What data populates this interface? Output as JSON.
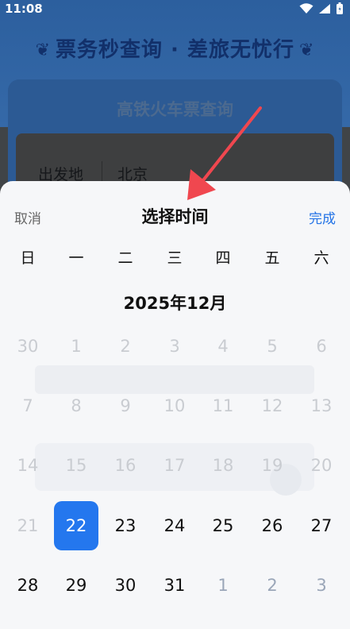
{
  "status_bar": {
    "time": "11:08"
  },
  "background": {
    "banner": "票务秒查询 · 差旅无忧行",
    "card_title": "高铁火车票查询",
    "field_label": "出发地",
    "field_value": "北京"
  },
  "sheet": {
    "cancel_label": "取消",
    "title": "选择时间",
    "done_label": "完成",
    "weekdays": [
      "日",
      "一",
      "二",
      "三",
      "四",
      "五",
      "六"
    ],
    "month_label": "2025年12月",
    "weeks": [
      [
        {
          "d": "30",
          "s": "faded"
        },
        {
          "d": "1",
          "s": "faded"
        },
        {
          "d": "2",
          "s": "faded"
        },
        {
          "d": "3",
          "s": "faded"
        },
        {
          "d": "4",
          "s": "faded"
        },
        {
          "d": "5",
          "s": "faded"
        },
        {
          "d": "6",
          "s": "faded"
        }
      ],
      [
        {
          "d": "7",
          "s": "faded"
        },
        {
          "d": "8",
          "s": "faded"
        },
        {
          "d": "9",
          "s": "faded"
        },
        {
          "d": "10",
          "s": "faded"
        },
        {
          "d": "11",
          "s": "faded"
        },
        {
          "d": "12",
          "s": "faded"
        },
        {
          "d": "13",
          "s": "faded"
        }
      ],
      [
        {
          "d": "14",
          "s": "faded"
        },
        {
          "d": "15",
          "s": "faded"
        },
        {
          "d": "16",
          "s": "faded"
        },
        {
          "d": "17",
          "s": "faded"
        },
        {
          "d": "18",
          "s": "faded"
        },
        {
          "d": "19",
          "s": "faded"
        },
        {
          "d": "20",
          "s": "faded"
        }
      ],
      [
        {
          "d": "21",
          "s": "faded"
        },
        {
          "d": "22",
          "s": "selected"
        },
        {
          "d": "23",
          "s": "normal"
        },
        {
          "d": "24",
          "s": "normal"
        },
        {
          "d": "25",
          "s": "normal"
        },
        {
          "d": "26",
          "s": "normal"
        },
        {
          "d": "27",
          "s": "normal"
        }
      ],
      [
        {
          "d": "28",
          "s": "normal"
        },
        {
          "d": "29",
          "s": "normal"
        },
        {
          "d": "30",
          "s": "normal"
        },
        {
          "d": "31",
          "s": "normal"
        },
        {
          "d": "1",
          "s": "next"
        },
        {
          "d": "2",
          "s": "next"
        },
        {
          "d": "3",
          "s": "next"
        }
      ]
    ],
    "selected_date": "22"
  },
  "colors": {
    "accent": "#2477ee",
    "annotation_arrow": "#f0474f"
  }
}
